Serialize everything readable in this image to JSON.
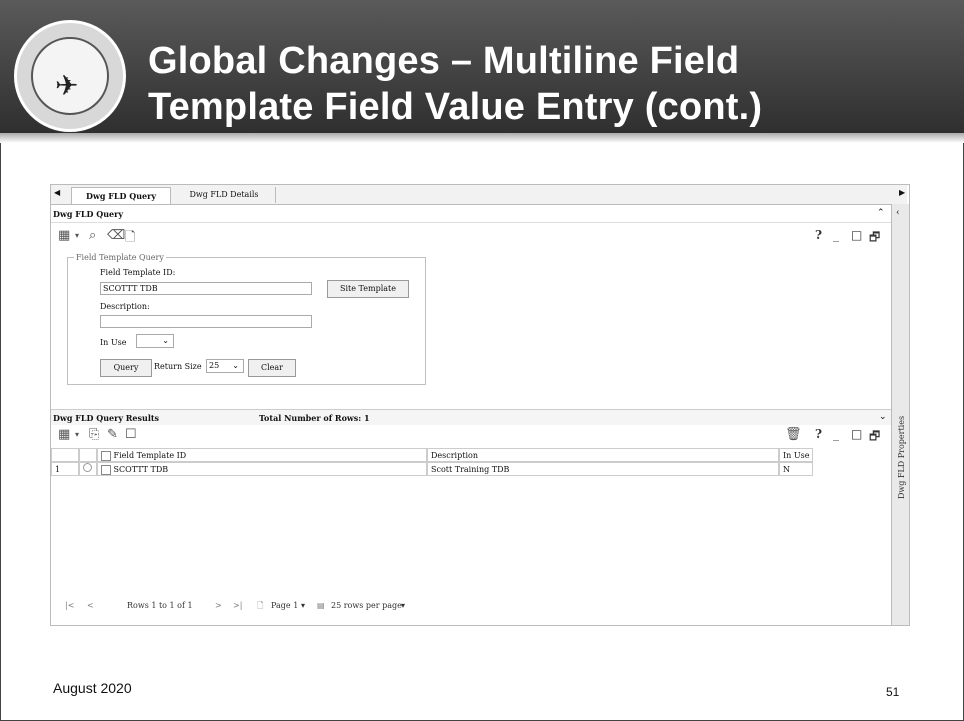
{
  "slide": {
    "title_line1": "Global Changes – Multiline Field",
    "title_line2": "Template Field Value Entry (cont.)",
    "footer_date": "August 2020",
    "page_number": "51",
    "logo_alt": "Joint Engineering Data Management Information and Control System"
  },
  "app": {
    "tabs": [
      {
        "label": "Dwg FLD Query"
      },
      {
        "label": "Dwg FLD Details"
      }
    ],
    "side_panel_label": "Dwg FLD Properties",
    "query_panel": {
      "title": "Dwg FLD Query",
      "toolbar_right": {
        "help": "?",
        "minimize": "_",
        "restore": "□",
        "maximize": "🗗"
      },
      "fieldset_legend": "Field Template Query",
      "field_template_id_label": "Field Template ID:",
      "field_template_id_value": "SCOTTT TDB",
      "site_template_button": "Site Template",
      "description_label": "Description:",
      "description_value": "",
      "in_use_label": "In Use",
      "in_use_value": "",
      "query_button": "Query",
      "return_size_label": "Return Size",
      "return_size_value": "25",
      "clear_button": "Clear"
    },
    "results_panel": {
      "title": "Dwg FLD Query Results",
      "total_rows": "Total Number of Rows: 1",
      "columns": [
        "Field Template ID",
        "Description",
        "In Use"
      ],
      "rows": [
        {
          "num": "1",
          "id": "SCOTTT TDB",
          "description": "Scott Training TDB",
          "in_use": "N"
        }
      ],
      "pager": {
        "rows_label": "Rows 1 to 1 of 1",
        "page_label": "Page 1",
        "per_page_label": "25 rows per page"
      }
    }
  },
  "icons": {
    "toolbar": [
      "table-icon",
      "search-icon",
      "clear-icon",
      "document-icon"
    ],
    "results_toolbar": [
      "table-icon",
      "copy-icon",
      "edit-icon",
      "new-icon",
      "delete-icon"
    ]
  }
}
